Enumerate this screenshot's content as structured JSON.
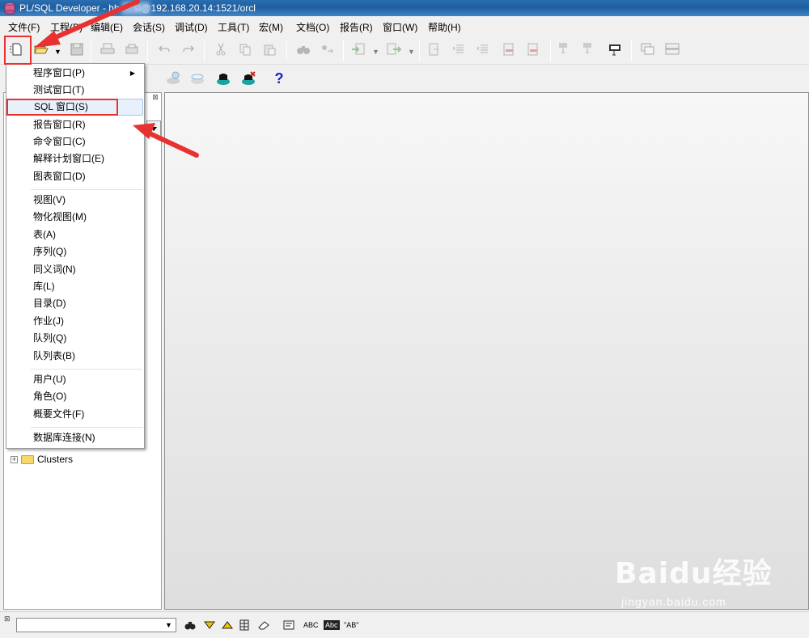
{
  "titlebar": {
    "title": "PL/SQL Developer - hb   si@192.168.20.14:1521/orcl"
  },
  "menubar": {
    "items": [
      "文件(F)",
      "工程(P)",
      "编辑(E)",
      "会话(S)",
      "调试(D)",
      "工具(T)",
      "宏(M)",
      "文档(O)",
      "报告(R)",
      "窗口(W)",
      "帮助(H)"
    ]
  },
  "toolbar2": {
    "help_label": "?"
  },
  "new_menu": {
    "items": [
      {
        "label": "程序窗口(P)",
        "has_submenu": true
      },
      {
        "label": "测试窗口(T)"
      },
      {
        "label": "SQL 窗口(S)",
        "highlighted": true
      },
      {
        "label": "报告窗口(R)"
      },
      {
        "label": "命令窗口(C)"
      },
      {
        "label": "解释计划窗口(E)"
      },
      {
        "label": "图表窗口(D)"
      },
      {
        "label": "视图(V)"
      },
      {
        "label": "物化视图(M)"
      },
      {
        "label": "表(A)"
      },
      {
        "label": "序列(Q)"
      },
      {
        "label": "同义词(N)"
      },
      {
        "label": "库(L)"
      },
      {
        "label": "目录(D)"
      },
      {
        "label": "作业(J)"
      },
      {
        "label": "队列(Q)"
      },
      {
        "label": "队列表(B)"
      },
      {
        "label": "用户(U)"
      },
      {
        "label": "角色(O)"
      },
      {
        "label": "概要文件(F)"
      },
      {
        "label": "数据库连接(N)"
      }
    ]
  },
  "object_tree": {
    "visible_node": "Clusters"
  },
  "bottombar": {
    "abc_label": "ABC",
    "abc2_label": "Abc",
    "ab_label": "\"AB\""
  },
  "watermark": {
    "logo": "Baidu经验",
    "url": "jingyan.baidu.com"
  },
  "colors": {
    "annotation_red": "#e8322f",
    "title_blue": "#2a6fb1",
    "menu_highlight": "#e8f0fb"
  }
}
